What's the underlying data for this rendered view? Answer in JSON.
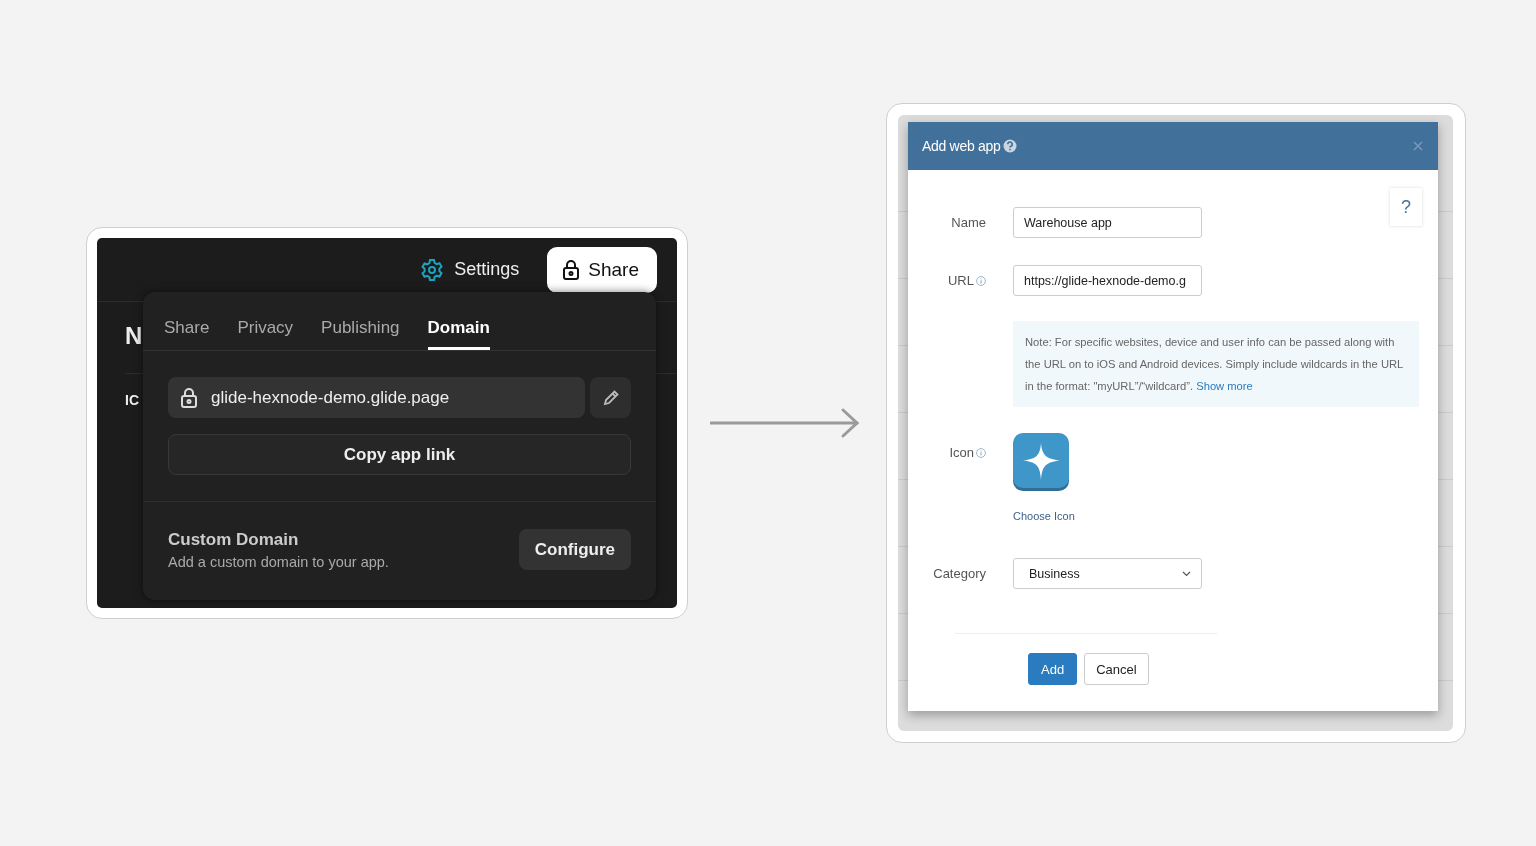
{
  "left_screen": {
    "background_texts": [
      "N",
      "IC"
    ],
    "settings_label": "Settings",
    "share_button": "Share",
    "tabs": [
      {
        "label": "Share",
        "selected": false
      },
      {
        "label": "Privacy",
        "selected": false
      },
      {
        "label": "Publishing",
        "selected": false
      },
      {
        "label": "Domain",
        "selected": true
      }
    ],
    "url": "glide-hexnode-demo.glide.page",
    "copy_button": "Copy app link",
    "custom_domain": {
      "title": "Custom Domain",
      "subtitle": "Add a custom domain to your app.",
      "button": "Configure"
    }
  },
  "right_screen": {
    "dialog": {
      "title": "Add web app",
      "help_button": "?",
      "fields": [
        {
          "label": "Name",
          "info": false,
          "value": "Warehouse app"
        },
        {
          "label": "URL",
          "info": true,
          "value": "https://glide-hexnode-demo.g"
        }
      ],
      "note": {
        "text": "Note: For specific websites, device and user info can be passed along with the URL on to iOS and Android devices. Simply include wildcards in the URL in the format: \"myURL”/“wildcard”.",
        "link": "Show more"
      },
      "icon": {
        "label": "Icon",
        "info": true,
        "link": "Choose Icon"
      },
      "category": {
        "label": "Category",
        "value": "Business"
      },
      "buttons": [
        {
          "label": "Add",
          "kind": "primary"
        },
        {
          "label": "Cancel",
          "kind": "secondary"
        }
      ]
    }
  }
}
